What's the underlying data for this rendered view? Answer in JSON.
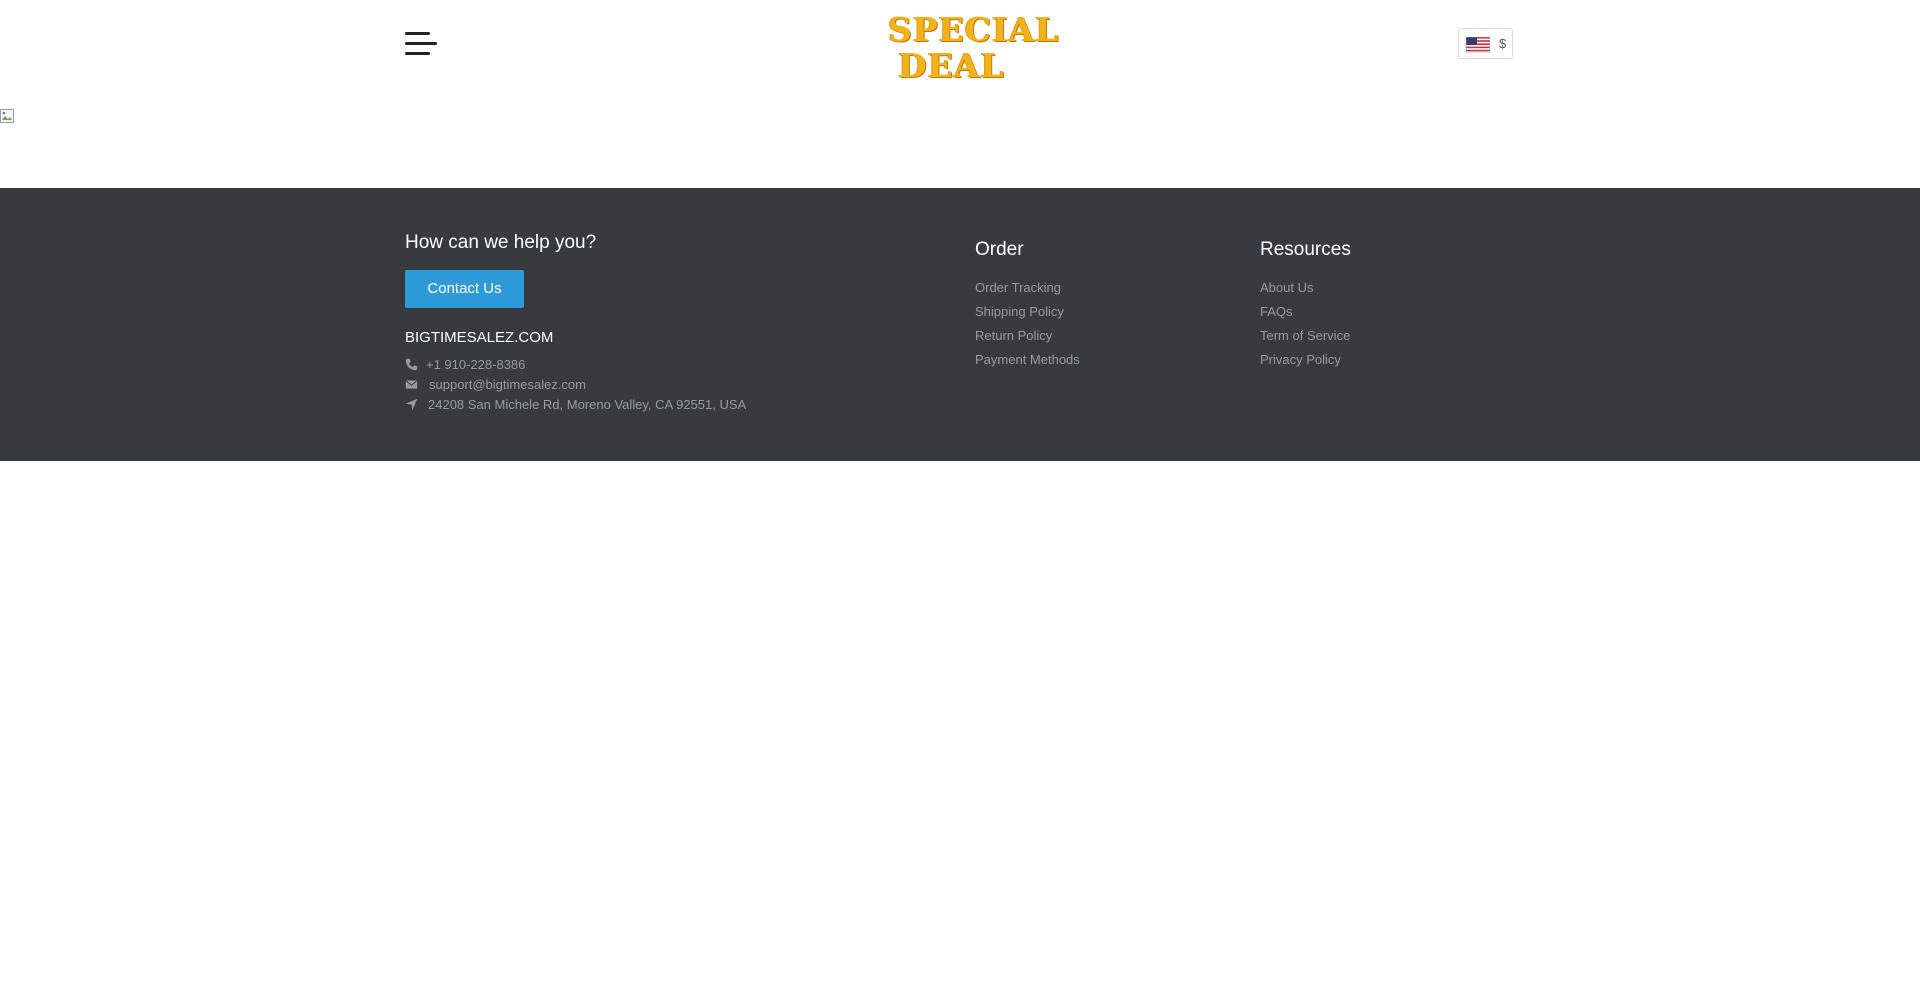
{
  "header": {
    "logo": {
      "line1": "SPECIAL",
      "line2": "DEAL"
    },
    "currency_symbol": "$",
    "flag_icon": "us-flag-icon"
  },
  "footer": {
    "help_title": "How can we help you?",
    "contact_button": "Contact Us",
    "site_name": "BIGTIMESALEZ.COM",
    "phone": "+1 910-228-8386",
    "email": "support@bigtimesalez.com",
    "address": "24208 San Michele Rd, Moreno Valley, CA 92551, USA",
    "order": {
      "title": "Order",
      "links": [
        "Order Tracking",
        "Shipping Policy",
        "Return Policy",
        "Payment Methods"
      ]
    },
    "resources": {
      "title": "Resources",
      "links": [
        "About Us",
        "FAQs",
        "Term of Service",
        "Privacy Policy"
      ]
    }
  },
  "colors": {
    "footer_bg": "#373a3f",
    "button_blue": "#2d9ad9",
    "logo_gold": "#f2b318"
  }
}
